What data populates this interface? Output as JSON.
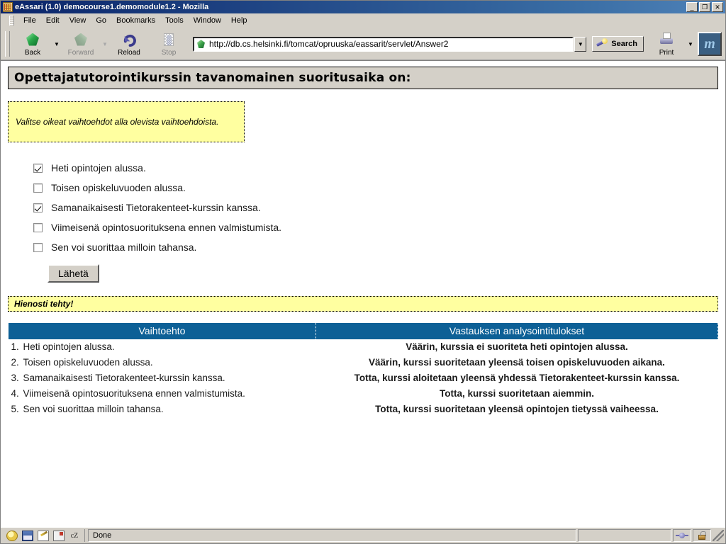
{
  "window": {
    "title": "eAssari (1.0) democourse1.demomodule1.2 - Mozilla",
    "minimize_label": "_",
    "restore_label": "❐",
    "close_label": "✕"
  },
  "menubar": {
    "items": [
      {
        "label": "File"
      },
      {
        "label": "Edit"
      },
      {
        "label": "View"
      },
      {
        "label": "Go"
      },
      {
        "label": "Bookmarks"
      },
      {
        "label": "Tools"
      },
      {
        "label": "Window"
      },
      {
        "label": "Help"
      }
    ]
  },
  "toolbar": {
    "back_label": "Back",
    "forward_label": "Forward",
    "reload_label": "Reload",
    "stop_label": "Stop",
    "search_label": "Search",
    "print_label": "Print",
    "dropdown_glyph": "▼",
    "mozilla_logo_text": "m"
  },
  "url_bar": {
    "value": "http://db.cs.helsinki.fi/tomcat/opruuska/eassarit/servlet/Answer2",
    "dropdown_glyph": "▼"
  },
  "page": {
    "heading": "Opettajatutorointikurssin tavanomainen suoritusaika on:",
    "instruction": "Valitse oikeat vaihtoehdot alla olevista vaihtoehdoista.",
    "options": [
      {
        "label": "Heti opintojen alussa.",
        "checked": true
      },
      {
        "label": "Toisen opiskeluvuoden alussa.",
        "checked": false
      },
      {
        "label": "Samanaikaisesti Tietorakenteet-kurssin kanssa.",
        "checked": true
      },
      {
        "label": "Viimeisenä opintosuorituksena ennen valmistumista.",
        "checked": false
      },
      {
        "label": "Sen voi suorittaa milloin tahansa.",
        "checked": false
      }
    ],
    "submit_label": "Lähetä",
    "feedback": "Hienosti tehty!",
    "results_table": {
      "headers": [
        "Vaihtoehto",
        "Vastauksen analysointitulokset"
      ],
      "rows": [
        {
          "num": "1.",
          "option": "Heti opintojen alussa.",
          "result": "Väärin, kurssia ei suoriteta heti opintojen alussa.",
          "verdict": "wrong"
        },
        {
          "num": "2.",
          "option": "Toisen opiskeluvuoden alussa.",
          "result": "Väärin, kurssi suoritetaan yleensä toisen opiskeluvuoden aikana.",
          "verdict": "wrong"
        },
        {
          "num": "3.",
          "option": "Samanaikaisesti Tietorakenteet-kurssin kanssa.",
          "result": "Totta, kurssi aloitetaan yleensä yhdessä Tietorakenteet-kurssin kanssa.",
          "verdict": "right"
        },
        {
          "num": "4.",
          "option": "Viimeisenä opintosuorituksena ennen valmistumista.",
          "result": "Totta, kurssi suoritetaan aiemmin.",
          "verdict": "right"
        },
        {
          "num": "5.",
          "option": "Sen voi suorittaa milloin tahansa.",
          "result": "Totta, kurssi suoritetaan yleensä opintojen tietyssä vaiheessa.",
          "verdict": "right"
        }
      ]
    }
  },
  "statusbar": {
    "message": "Done",
    "component_icon_cz_label": "cZ"
  },
  "colors": {
    "table_header_bg": "#0d6096",
    "wrong_text": "#e33a16",
    "right_text": "#1a86ad",
    "highlight_bg": "#ffffa0",
    "titlebar_start": "#0a246a"
  }
}
